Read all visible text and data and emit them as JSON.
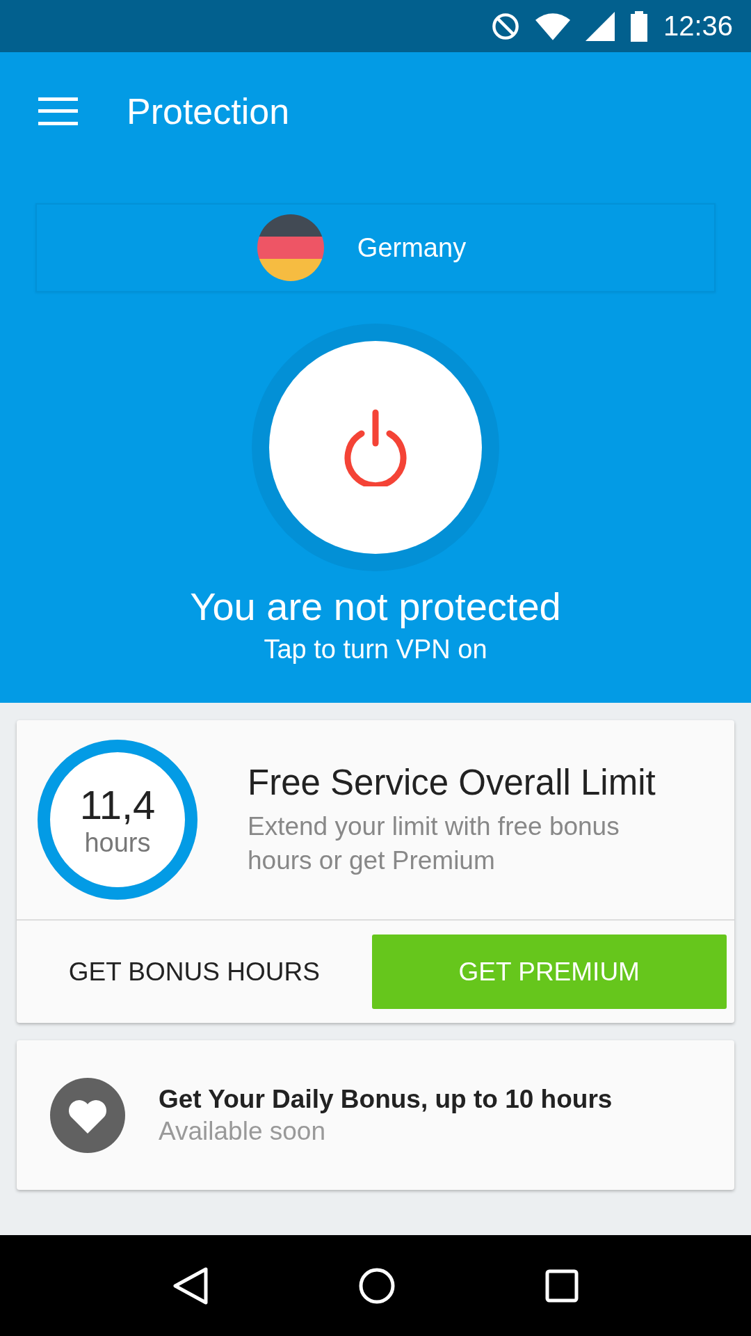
{
  "status_bar": {
    "time": "12:36"
  },
  "app_bar": {
    "title": "Protection"
  },
  "location": {
    "country": "Germany"
  },
  "vpn": {
    "protected": false,
    "status": "You are not protected",
    "hint": "Tap to turn VPN on"
  },
  "limit_card": {
    "value": "11,4",
    "unit": "hours",
    "title": "Free Service Overall Limit",
    "description": "Extend your limit with free bonus hours or get Premium",
    "buttons": [
      {
        "label": "GET BONUS HOURS",
        "kind": "flat"
      },
      {
        "label": "GET PREMIUM",
        "kind": "primary"
      }
    ]
  },
  "bonus_card": {
    "title": "Get Your Daily Bonus, up to 10 hours",
    "subtitle": "Available soon"
  }
}
